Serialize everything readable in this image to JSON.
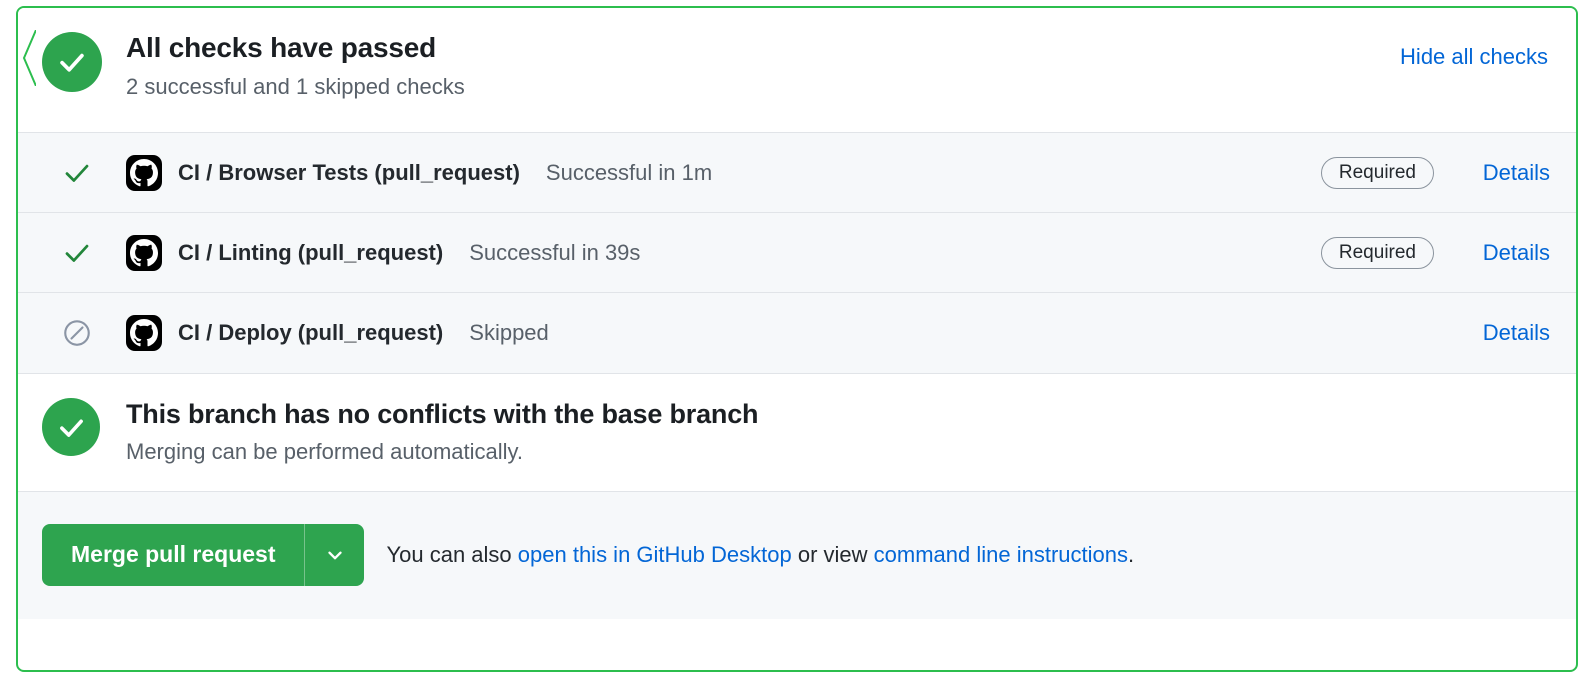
{
  "box": {
    "border_color": "#2cbe4e",
    "success_color": "#2da44e",
    "link_color": "#0366d6"
  },
  "header": {
    "status_icon": "check-circle-icon",
    "title": "All checks have passed",
    "subtitle": "2 successful and 1 skipped checks",
    "action_label": "Hide all checks"
  },
  "checks": [
    {
      "status_icon": "check-icon",
      "avatar_icon": "github-octocat-icon",
      "name": "CI / Browser Tests (pull_request)",
      "description": "Successful in 1m",
      "required_label": "Required",
      "details_label": "Details"
    },
    {
      "status_icon": "check-icon",
      "avatar_icon": "github-octocat-icon",
      "name": "CI / Linting (pull_request)",
      "description": "Successful in 39s",
      "required_label": "Required",
      "details_label": "Details"
    },
    {
      "status_icon": "skipped-icon",
      "avatar_icon": "github-octocat-icon",
      "name": "CI / Deploy (pull_request)",
      "description": "Skipped",
      "required_label": "",
      "details_label": "Details"
    }
  ],
  "conflicts": {
    "status_icon": "check-circle-icon",
    "title": "This branch has no conflicts with the base branch",
    "subtitle": "Merging can be performed automatically."
  },
  "footer": {
    "merge_label": "Merge pull request",
    "caret_icon": "chevron-down-icon",
    "text_before": "You can also ",
    "link_desktop": "open this in GitHub Desktop",
    "text_middle": " or view ",
    "link_cli": "command line instructions",
    "text_after": "."
  }
}
